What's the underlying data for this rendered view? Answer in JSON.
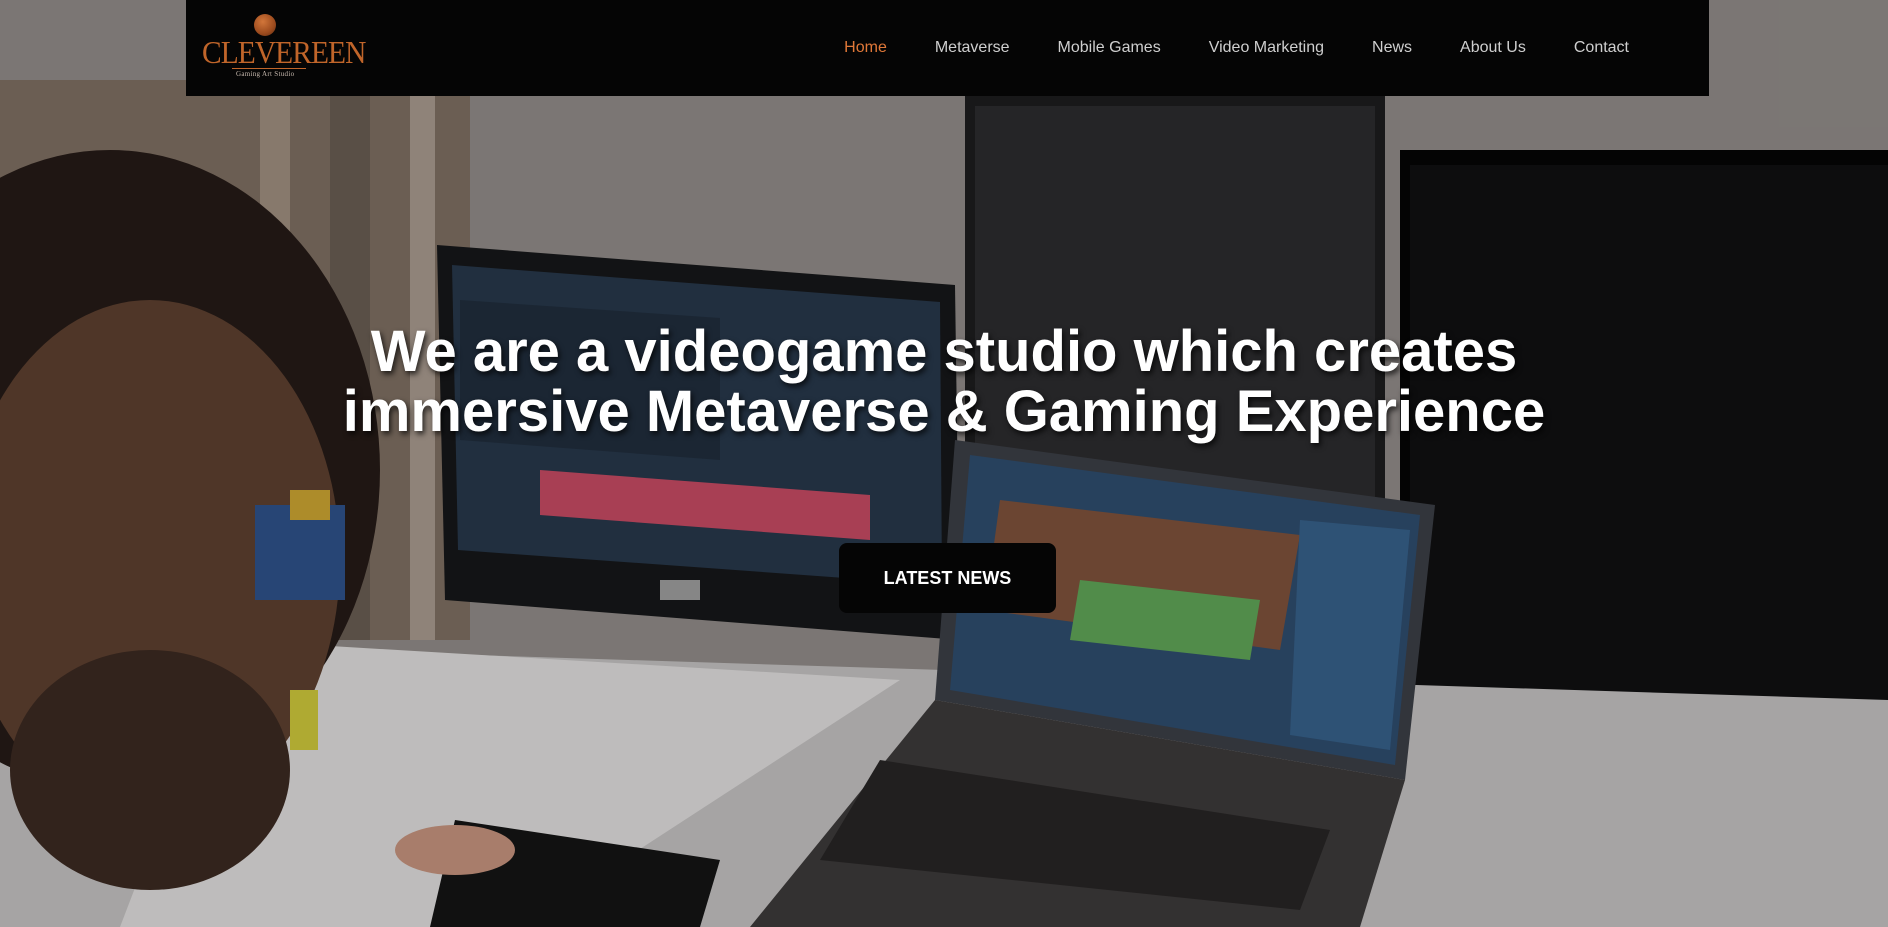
{
  "brand": {
    "logo_text": "CLEVEREEN",
    "logo_subtitle": "Gaming Art Studio"
  },
  "nav": {
    "items": [
      {
        "label": "Home",
        "active": true
      },
      {
        "label": "Metaverse",
        "active": false
      },
      {
        "label": "Mobile Games",
        "active": false
      },
      {
        "label": "Video Marketing",
        "active": false
      },
      {
        "label": "News",
        "active": false
      },
      {
        "label": "About Us",
        "active": false
      },
      {
        "label": "Contact",
        "active": false
      }
    ]
  },
  "hero": {
    "headline_line1": "We are a videogame studio which creates",
    "headline_line2": "immersive Metaverse & Gaming Experience",
    "cta_label": "LATEST NEWS"
  },
  "colors": {
    "nav_background": "#050505",
    "nav_active": "#e07838",
    "nav_text": "#cfcfcf",
    "logo_accent": "#c0652a",
    "headline": "#ffffff",
    "cta_background": "#050505"
  }
}
